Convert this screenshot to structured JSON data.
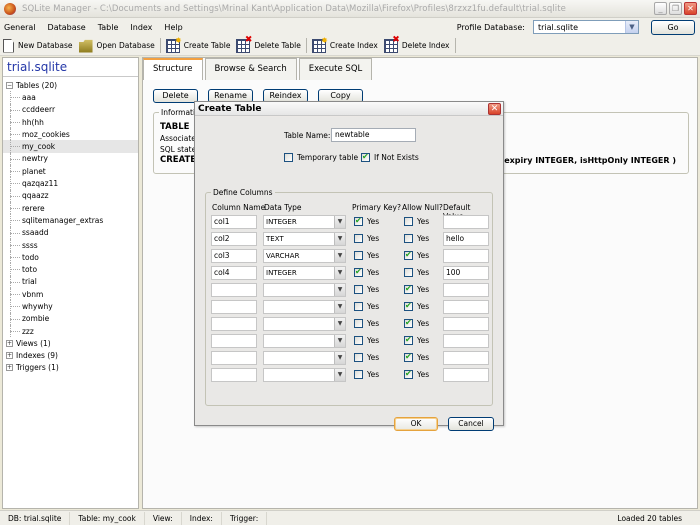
{
  "window": {
    "title": "SQLite Manager - C:\\Documents and Settings\\Mrinal Kant\\Application Data\\Mozilla\\Firefox\\Profiles\\8rzxz1fu.default\\trial.sqlite",
    "controls": {
      "minimize": "_",
      "maximize": "❐",
      "close": "✕"
    }
  },
  "menu": [
    "General",
    "Database",
    "Table",
    "Index",
    "Help"
  ],
  "profile": {
    "label": "Profile Database:",
    "value": "trial.sqlite",
    "go_label": "Go"
  },
  "toolbar": [
    {
      "label": "New Database",
      "icon": "new-document-icon"
    },
    {
      "label": "Open Database",
      "icon": "open-folder-icon"
    },
    {
      "label": "Create Table",
      "icon": "create-table-icon"
    },
    {
      "label": "Delete Table",
      "icon": "delete-table-icon"
    },
    {
      "label": "Create Index",
      "icon": "create-index-icon"
    },
    {
      "label": "Delete Index",
      "icon": "delete-index-icon"
    }
  ],
  "sidebar": {
    "db_name": "trial.sqlite",
    "tables_label": "Tables (20)",
    "tables": [
      "aaa",
      "ccddeerr",
      "hh(hh",
      "moz_cookies",
      "my_cook",
      "newtry",
      "planet",
      "qazqaz11",
      "qqaazz",
      "rerere",
      "sqlitemanager_extras",
      "ssaadd",
      "ssss",
      "todo",
      "toto",
      "trial",
      "vbnm",
      "whywhy",
      "zombie",
      "zzz"
    ],
    "selected": "my_cook",
    "groups": [
      {
        "label": "Views (1)"
      },
      {
        "label": "Indexes (9)"
      },
      {
        "label": "Triggers (1)"
      }
    ]
  },
  "tabs": [
    {
      "label": "Structure",
      "active": true
    },
    {
      "label": "Browse & Search",
      "active": false
    },
    {
      "label": "Execute SQL",
      "active": false
    }
  ],
  "actions": [
    "Delete",
    "Rename",
    "Reindex",
    "Copy"
  ],
  "info": {
    "legend": "Information",
    "type": "TABLE",
    "associated": "Associated",
    "sql_statement": "SQL statement",
    "create": "CREATE",
    "create_tail": ", expiry INTEGER, isHttpOnly INTEGER )"
  },
  "dialog": {
    "title": "Create Table",
    "table_name_label": "Table Name:",
    "table_name": "newtable",
    "temporary": {
      "label": "Temporary table",
      "checked": false
    },
    "if_not_exists": {
      "label": "If Not Exists",
      "checked": true
    },
    "define_columns_legend": "Define Columns",
    "headers": {
      "name": "Column Name",
      "type": "Data Type",
      "pk": "Primary Key?",
      "null": "Allow Null?",
      "default": "Default Value"
    },
    "yes_label": "Yes",
    "rows": [
      {
        "name": "col1",
        "type": "INTEGER",
        "pk": true,
        "null": false,
        "default": ""
      },
      {
        "name": "col2",
        "type": "TEXT",
        "pk": false,
        "null": false,
        "default": "hello"
      },
      {
        "name": "col3",
        "type": "VARCHAR",
        "pk": false,
        "null": true,
        "default": ""
      },
      {
        "name": "col4",
        "type": "INTEGER",
        "pk": true,
        "null": false,
        "default": "100"
      },
      {
        "name": "",
        "type": "",
        "pk": false,
        "null": true,
        "default": ""
      },
      {
        "name": "",
        "type": "",
        "pk": false,
        "null": true,
        "default": ""
      },
      {
        "name": "",
        "type": "",
        "pk": false,
        "null": true,
        "default": ""
      },
      {
        "name": "",
        "type": "",
        "pk": false,
        "null": true,
        "default": ""
      },
      {
        "name": "",
        "type": "",
        "pk": false,
        "null": true,
        "default": ""
      },
      {
        "name": "",
        "type": "",
        "pk": false,
        "null": true,
        "default": ""
      }
    ],
    "ok_label": "OK",
    "cancel_label": "Cancel"
  },
  "status": {
    "db": "DB: trial.sqlite",
    "table": "Table: my_cook",
    "view": "View:",
    "index": "Index:",
    "trigger": "Trigger:",
    "message": "Loaded 20 tables"
  }
}
